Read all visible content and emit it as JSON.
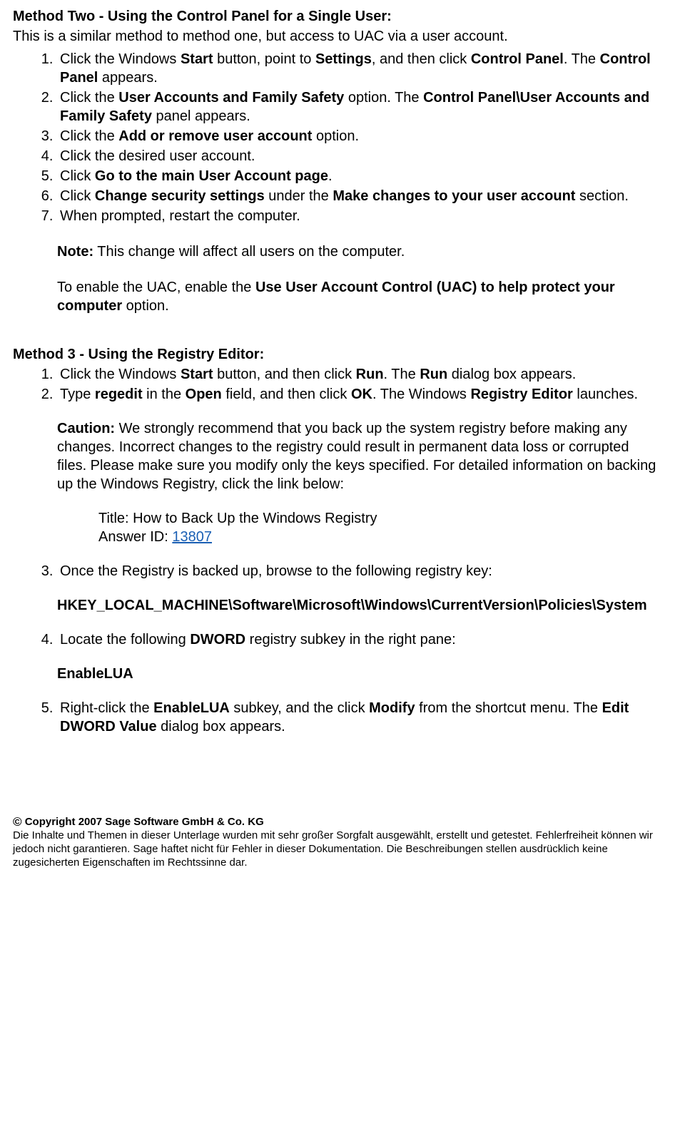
{
  "m2": {
    "heading": "Method Two - Using the Control Panel for a Single User:",
    "intro": "This is a similar method to method one, but access to UAC via a user account.",
    "s1a": "Click the Windows ",
    "s1b": "Start",
    "s1c": " button, point to ",
    "s1d": "Settings",
    "s1e": ", and then click ",
    "s1f": "Control Panel",
    "s1g": ". The ",
    "s1h": "Control Panel",
    "s1i": " appears.",
    "s2a": "Click the ",
    "s2b": "User Accounts and Family Safety",
    "s2c": " option. The ",
    "s2d": "Control Panel\\User Accounts and Family Safety",
    "s2e": " panel appears.",
    "s3a": "Click the ",
    "s3b": "Add or remove user account",
    "s3c": " option.",
    "s4": "Click the desired user account.",
    "s5a": "Click ",
    "s5b": "Go to the main User Account page",
    "s5c": ".",
    "s6a": "Click ",
    "s6b": "Change security settings",
    "s6c": " under the ",
    "s6d": "Make changes to your user account",
    "s6e": " section.",
    "s7": "When prompted, restart the computer.",
    "note_b": "Note:",
    "note_t": " This change will affect all users on the computer.",
    "en_a": "To enable the UAC, enable the ",
    "en_b": "Use User Account Control (UAC) to help protect your computer",
    "en_c": " option."
  },
  "m3": {
    "heading": "Method 3 - Using the Registry Editor:",
    "s1a": "Click the Windows ",
    "s1b": "Start",
    "s1c": " button, and then click ",
    "s1d": "Run",
    "s1e": ". The ",
    "s1f": "Run",
    "s1g": " dialog box appears.",
    "s2a": "Type ",
    "s2b": "regedit",
    "s2c": " in the ",
    "s2d": "Open",
    "s2e": " field, and then click ",
    "s2f": "OK",
    "s2g": ". The Windows ",
    "s2h": "Registry Editor",
    "s2i": " launches.",
    "caut_b": "Caution:",
    "caut_t": " We strongly recommend that you back up the system registry before making any changes. Incorrect changes to the registry could result in permanent data loss or corrupted files. Please make sure you modify only the keys specified. For detailed information on backing up the Windows Registry, click the link below:",
    "ref_title": "Title: How to Back Up the Windows Registry",
    "ref_ans_lbl": "Answer ID: ",
    "ref_ans_link": "13807",
    "s3": "Once the Registry is backed up, browse to the following registry key:",
    "regkey": "HKEY_LOCAL_MACHINE\\Software\\Microsoft\\Windows\\CurrentVersion\\Policies\\System",
    "s4a": "Locate the following ",
    "s4b": "DWORD",
    "s4c": " registry subkey in the right pane:",
    "dword": "EnableLUA",
    "s5a": "Right-click the ",
    "s5b": "EnableLUA",
    "s5c": " subkey, and the click ",
    "s5d": "Modify",
    "s5e": " from the shortcut menu. The ",
    "s5f": "Edit DWORD Value",
    "s5g": " dialog box appears."
  },
  "footer": {
    "copy": " Copyright 2007 Sage Software GmbH & Co. KG",
    "txt": "Die Inhalte und Themen in dieser Unterlage wurden mit sehr großer Sorgfalt ausgewählt, erstellt und getestet. Fehlerfreiheit können wir jedoch nicht garantieren. Sage haftet nicht für Fehler in dieser Dokumentation. Die Beschreibungen stellen ausdrücklich keine zugesicherten Eigenschaften im Rechtssinne dar."
  }
}
